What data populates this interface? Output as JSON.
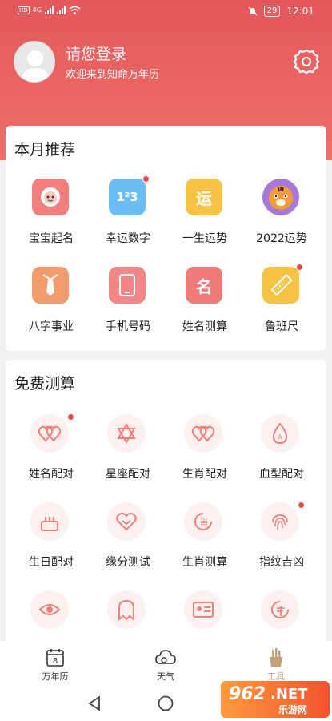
{
  "status": {
    "left_tag": "HD",
    "net": "4G",
    "battery": "29",
    "time": "12:01"
  },
  "header": {
    "title": "请您登录",
    "subtitle": "欢迎来到知命万年历"
  },
  "monthly": {
    "title": "本月推荐",
    "items": [
      {
        "label": "宝宝起名",
        "icon": "baby-face-icon",
        "badge": false
      },
      {
        "label": "幸运数字",
        "icon": "numbers-icon",
        "badge": true
      },
      {
        "label": "一生运势",
        "icon": "yun-character-icon",
        "badge": false
      },
      {
        "label": "2022运势",
        "icon": "tiger-icon",
        "badge": false
      },
      {
        "label": "八字事业",
        "icon": "tie-icon",
        "badge": false
      },
      {
        "label": "手机号码",
        "icon": "phone-icon",
        "badge": false
      },
      {
        "label": "姓名测算",
        "icon": "ming-character-icon",
        "badge": false
      },
      {
        "label": "鲁班尺",
        "icon": "ruler-icon",
        "badge": true
      }
    ]
  },
  "free": {
    "title": "免费测算",
    "items": [
      {
        "label": "姓名配对",
        "icon": "double-heart-icon",
        "badge": true
      },
      {
        "label": "星座配对",
        "icon": "star-of-david-icon",
        "badge": false
      },
      {
        "label": "生肖配对",
        "icon": "linked-hearts-icon",
        "badge": false
      },
      {
        "label": "血型配对",
        "icon": "blood-drop-icon",
        "badge": false
      },
      {
        "label": "生日配对",
        "icon": "cake-icon",
        "badge": false
      },
      {
        "label": "缘分测试",
        "icon": "heart-outline-icon",
        "badge": false
      },
      {
        "label": "生肖测算",
        "icon": "xiao-character-icon",
        "badge": false
      },
      {
        "label": "指纹吉凶",
        "icon": "fingerprint-icon",
        "badge": true
      },
      {
        "label": "",
        "icon": "eye-icon",
        "badge": false
      },
      {
        "label": "",
        "icon": "ghost-icon",
        "badge": false
      },
      {
        "label": "",
        "icon": "id-card-icon",
        "badge": false
      },
      {
        "label": "",
        "icon": "circle-stamp-icon",
        "badge": false
      }
    ]
  },
  "tabs": [
    {
      "label": "万年历",
      "icon": "calendar-icon",
      "day": "8",
      "active": false
    },
    {
      "label": "天气",
      "icon": "cloud-icon",
      "active": false
    },
    {
      "label": "工具",
      "icon": "tools-icon",
      "active": true
    }
  ],
  "watermark": {
    "text1": "962",
    "text2": ".NET",
    "text3": "乐游网"
  },
  "colors": {
    "brand": "#e4585b",
    "accent_icon": "#ef7f7b",
    "active_tab": "#c3a27a",
    "badge": "#e94b4b"
  }
}
